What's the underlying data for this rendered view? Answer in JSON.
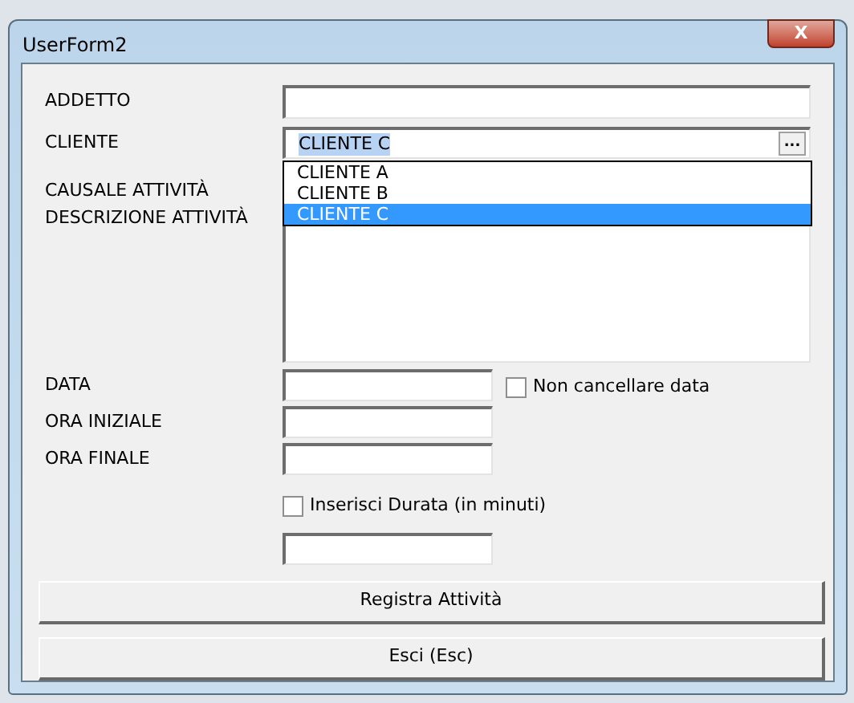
{
  "window": {
    "title": "UserForm2",
    "close_label": "X"
  },
  "fields": [
    {
      "kind": "text",
      "label": "ADDETTO"
    },
    {
      "kind": "combo",
      "label": "CLIENTE",
      "value": "CLIENTE C",
      "button": "...",
      "expanded": true,
      "options": [
        {
          "label": "CLIENTE A",
          "selected": false
        },
        {
          "label": "CLIENTE B",
          "selected": false
        },
        {
          "label": "CLIENTE C",
          "selected": true
        }
      ]
    },
    {
      "kind": "hidden",
      "label": "CAUSALE ATTIVITÀ"
    },
    {
      "kind": "memo",
      "label": "DESCRIZIONE ATTIVITÀ"
    },
    {
      "kind": "short",
      "label": "DATA",
      "checkbox": {
        "label": "Non cancellare data",
        "checked": false
      }
    },
    {
      "kind": "short",
      "label": "ORA INIZIALE"
    },
    {
      "kind": "short",
      "label": "ORA FINALE"
    }
  ],
  "duration": {
    "checkbox": {
      "label": "Inserisci Durata (in minuti)",
      "checked": false
    }
  },
  "buttons": [
    "Registra Attività",
    "Esci (Esc)"
  ]
}
